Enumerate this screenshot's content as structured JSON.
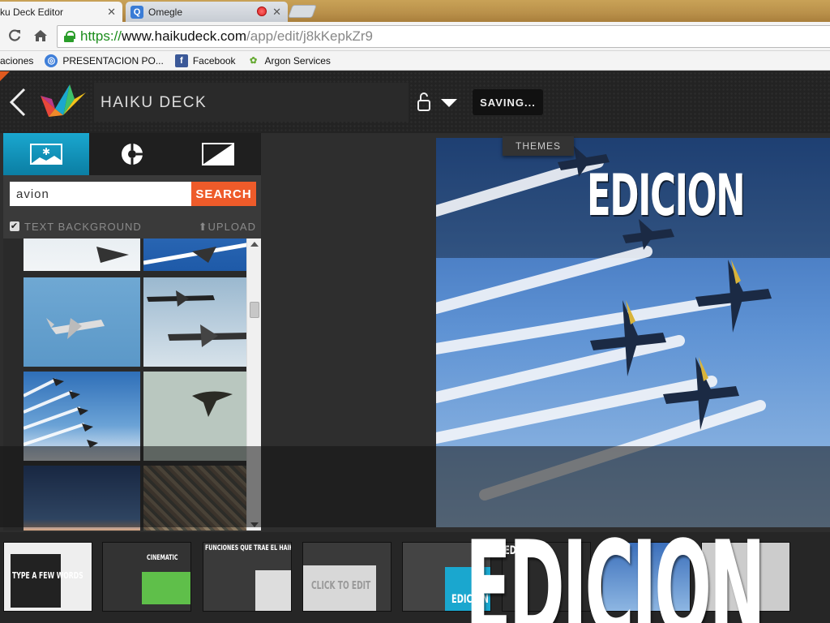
{
  "browser": {
    "tabs": [
      {
        "title": "ku Deck Editor",
        "active": true
      },
      {
        "title": "Omegle",
        "active": false
      }
    ],
    "url": {
      "scheme": "https://",
      "host": "www.haikudeck.com",
      "path": "/app/edit/j8kKepkZr9"
    },
    "bookmarks": [
      {
        "label": "aciones",
        "icon": "folder-icon"
      },
      {
        "label": "PRESENTACION PO...",
        "icon": "globe-icon"
      },
      {
        "label": "Facebook",
        "icon": "facebook-icon"
      },
      {
        "label": "Argon Services",
        "icon": "argon-icon"
      }
    ]
  },
  "app": {
    "title": "HAIKU DECK",
    "saving_label": "SAVING...",
    "themes_label": "THEMES",
    "search": {
      "value": "avion",
      "button": "SEARCH"
    },
    "options": {
      "text_background_label": "TEXT BACKGROUND",
      "text_background_checked": true,
      "upload_label": "UPLOAD"
    },
    "slide": {
      "title": "EDICION"
    },
    "overlay_text": "EDICION",
    "filmstrip": [
      {
        "label": "TYPE A FEW WORDS"
      },
      {
        "label": "CINEMATIC"
      },
      {
        "label": "FUNCIONES QUE TRAE EL HAIKU DECK"
      },
      {
        "label": "CLICK TO EDIT"
      },
      {
        "label": "EDICION"
      },
      {
        "label": "EDICION"
      },
      {
        "label": ""
      },
      {
        "label": ""
      }
    ]
  },
  "colors": {
    "accent_orange": "#ee5b2a",
    "accent_blue": "#1aa7cf"
  }
}
